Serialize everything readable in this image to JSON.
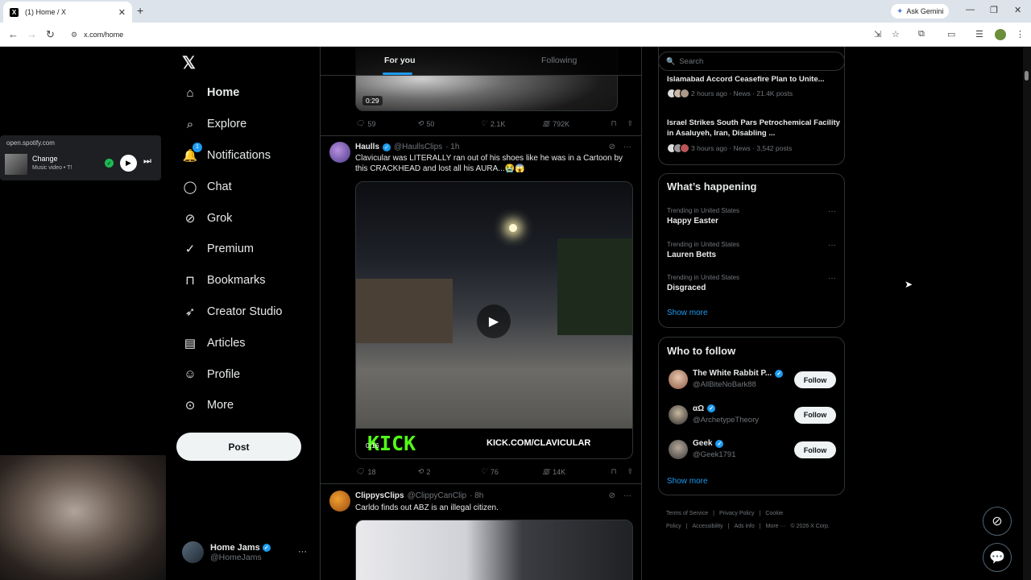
{
  "browser": {
    "tab_title": "(1) Home / X",
    "tab_favicon": "X",
    "url": "x.com/home",
    "gemini_label": "Ask Gemini"
  },
  "nav": {
    "items": [
      {
        "label": "Home",
        "icon": "home-icon"
      },
      {
        "label": "Explore",
        "icon": "search-icon"
      },
      {
        "label": "Notifications",
        "icon": "bell-icon",
        "badge": "1"
      },
      {
        "label": "Chat",
        "icon": "chat-icon"
      },
      {
        "label": "Grok",
        "icon": "grok-icon"
      },
      {
        "label": "Premium",
        "icon": "premium-icon"
      },
      {
        "label": "Bookmarks",
        "icon": "bookmark-icon"
      },
      {
        "label": "Creator Studio",
        "icon": "rocket-icon"
      },
      {
        "label": "Articles",
        "icon": "article-icon"
      },
      {
        "label": "Profile",
        "icon": "profile-icon"
      },
      {
        "label": "More",
        "icon": "more-icon"
      }
    ],
    "post_label": "Post",
    "account": {
      "name": "Home Jams",
      "handle": "@HomeJams"
    }
  },
  "spotify": {
    "site": "open.spotify.com",
    "song": "Change",
    "sub": "Music video • T!"
  },
  "timeline": {
    "tabs": [
      "For you",
      "Following"
    ],
    "post0": {
      "duration": "0:29",
      "replies": "59",
      "reposts": "50",
      "likes": "2.1K",
      "views": "792K"
    },
    "post1": {
      "name": "Haulls",
      "handle": "@HaullsClips",
      "time": "· 1h",
      "text": "Clavicular was LITERALLY ran out of his shoes like he was in a Cartoon by this CRACKHEAD and lost all his AURA...😭😱",
      "overlay_left": "KICK",
      "overlay_right": "KICK.COM/CLAVICULAR",
      "duration": "0:16",
      "replies": "18",
      "reposts": "2",
      "likes": "76",
      "views": "14K"
    },
    "post2": {
      "name": "ClippysClips",
      "handle": "@ClippyCanClip",
      "time": "· 8h",
      "text": "Carldo finds out ABZ is an illegal citizen."
    }
  },
  "right": {
    "search_placeholder": "Search",
    "news": [
      {
        "title": "Islamabad Accord Ceasefire Plan to Unite...",
        "meta": "2 hours ago · News · 21.4K posts"
      },
      {
        "title": "Israel Strikes South Pars Petrochemical Facility in Asaluyeh, Iran, Disabling ...",
        "meta": "3 hours ago · News · 3,542 posts"
      }
    ],
    "happening": {
      "heading": "What’s happening",
      "items": [
        {
          "caption": "Trending in United States",
          "name": "Happy Easter"
        },
        {
          "caption": "Trending in United States",
          "name": "Lauren Betts"
        },
        {
          "caption": "Trending in United States",
          "name": "Disgraced"
        }
      ],
      "show_more": "Show more"
    },
    "who_to_follow": {
      "heading": "Who to follow",
      "items": [
        {
          "name": "The White Rabbit P...",
          "handle": "@AllBiteNoBark88",
          "button": "Follow"
        },
        {
          "name": "αΩ",
          "handle": "@ArchetypeTheory",
          "button": "Follow"
        },
        {
          "name": "Geek",
          "handle": "@Geek1791",
          "button": "Follow"
        }
      ],
      "show_more": "Show more"
    },
    "footer": {
      "links": [
        "Terms of Service",
        "|",
        "Privacy Policy",
        "|",
        "Cookie Policy",
        "|",
        "Accessibility",
        "|",
        "Ads info",
        "|",
        "More ···",
        "© 2026 X Corp."
      ]
    }
  },
  "colors": {
    "accent": "#1d9bf0",
    "background": "#000000",
    "text": "#e7e9ea",
    "muted": "#71767b",
    "border": "#2f3336"
  }
}
